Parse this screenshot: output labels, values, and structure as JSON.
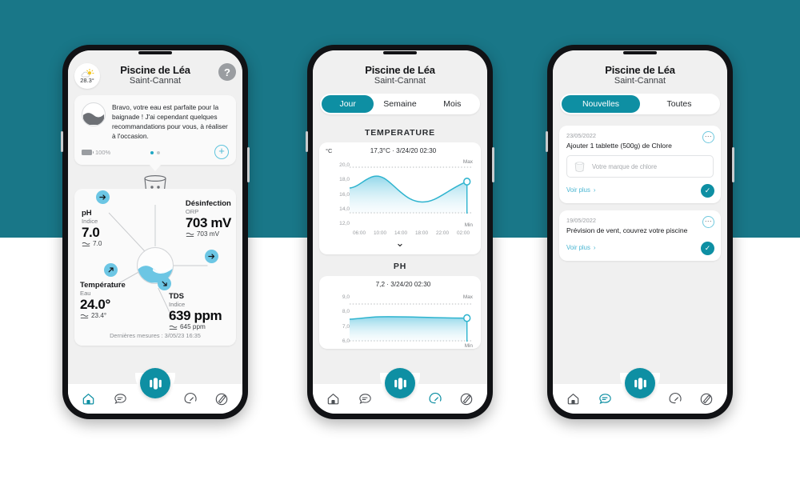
{
  "background": {
    "teal": "#197788",
    "white": "#ffffff"
  },
  "theme": {
    "accent": "#0e8fa3",
    "accent_light": "#4ab6d2",
    "chart_fill": "#5ec4e0",
    "muted": "#9a9da1"
  },
  "phone1": {
    "header": {
      "title": "Piscine de Léa",
      "subtitle": "Saint-Cannat",
      "weather_temp": "28.3°",
      "weather_icon": "sun-behind-cloud-icon",
      "help_label": "?"
    },
    "advice": {
      "avatar_icon": "water-wave-avatar-icon",
      "text": "Bravo, votre eau est parfaite pour la baignade ! J'ai cependant quelques recommandations pour vous, à réaliser à l'occasion.",
      "battery_label": "100%",
      "battery_icon": "battery-full-icon",
      "add_label": "+",
      "dots": 2,
      "active_dot": 0
    },
    "device_icon": "pool-sensor-device-icon",
    "hub_icon": "water-wave-logo-icon",
    "metrics": [
      {
        "name": "pH",
        "kind": "Indice",
        "value": "7.0",
        "previous": "7.0",
        "arrow": "arrow-right-icon",
        "trend": "flat"
      },
      {
        "name": "Désinfection",
        "kind": "ORP",
        "value": "703 mV",
        "previous": "703 mV",
        "arrow": "arrow-right-icon",
        "trend": "flat"
      },
      {
        "name": "Température",
        "kind": "Eau",
        "value": "24.0°",
        "previous": "23.4°",
        "arrow": "arrow-up-right-icon",
        "trend": "up"
      },
      {
        "name": "TDS",
        "kind": "Indice",
        "value": "639 ppm",
        "previous": "645 ppm",
        "arrow": "arrow-down-right-icon",
        "trend": "down"
      }
    ],
    "last_measure": "Dernières mesures : 3/05/23 16:35",
    "nav": {
      "items": [
        {
          "icon": "home-icon",
          "name": "nav-home",
          "active": true
        },
        {
          "icon": "chat-bubble-icon",
          "name": "nav-messages",
          "active": false
        },
        {
          "icon": "gauge-icon",
          "name": "nav-gauge",
          "active": false
        },
        {
          "icon": "test-strip-icon",
          "name": "nav-analysis",
          "active": false
        }
      ],
      "fab_icon": "device-capsule-icon"
    }
  },
  "phone2": {
    "header": {
      "title": "Piscine de Léa",
      "subtitle": "Saint-Cannat"
    },
    "tabs": [
      {
        "label": "Jour",
        "active": true
      },
      {
        "label": "Semaine",
        "active": false
      },
      {
        "label": "Mois",
        "active": false
      }
    ],
    "chevron": "chevron-down-icon",
    "nav": {
      "items": [
        {
          "icon": "home-icon",
          "name": "nav-home",
          "active": false
        },
        {
          "icon": "chat-bubble-icon",
          "name": "nav-messages",
          "active": false
        },
        {
          "icon": "gauge-icon",
          "name": "nav-gauge",
          "active": true
        },
        {
          "icon": "test-strip-icon",
          "name": "nav-analysis",
          "active": false
        }
      ],
      "fab_icon": "device-capsule-icon"
    }
  },
  "phone3": {
    "header": {
      "title": "Piscine de Léa",
      "subtitle": "Saint-Cannat"
    },
    "tabs": [
      {
        "label": "Nouvelles",
        "active": true
      },
      {
        "label": "Toutes",
        "active": false
      }
    ],
    "notifications": [
      {
        "date": "23/05/2022",
        "title": "Ajouter 1 tablette (500g) de Chlore",
        "product_placeholder": "Votre marque de chlore",
        "product_icon": "chlorine-bucket-icon",
        "see_more": "Voir plus",
        "more_icon": "more-options-icon",
        "check_icon": "check-circle-icon"
      },
      {
        "date": "19/05/2022",
        "title": "Prévision de vent, couvrez votre piscine",
        "product_placeholder": null,
        "see_more": "Voir plus",
        "more_icon": "more-options-icon",
        "check_icon": "check-circle-icon"
      }
    ],
    "nav": {
      "items": [
        {
          "icon": "home-icon",
          "name": "nav-home",
          "active": false
        },
        {
          "icon": "chat-bubble-icon",
          "name": "nav-messages",
          "active": true
        },
        {
          "icon": "gauge-icon",
          "name": "nav-gauge",
          "active": false
        },
        {
          "icon": "test-strip-icon",
          "name": "nav-analysis",
          "active": false
        }
      ],
      "fab_icon": "device-capsule-icon"
    }
  },
  "chart_data": [
    {
      "type": "area",
      "title": "TEMPERATURE",
      "caption": "17,3°C · 3/24/20 02:30",
      "unit_label": "°C",
      "ylabel": "°C",
      "xlabel": "",
      "ylim": [
        12.0,
        20.0
      ],
      "yticks": [
        "20,0",
        "18,0",
        "16,0",
        "14,0",
        "12,0"
      ],
      "ytick_values": [
        20.0,
        18.0,
        16.0,
        14.0,
        12.0
      ],
      "xticks": [
        "06:00",
        "10:00",
        "14:00",
        "18:00",
        "22:00",
        "02:00"
      ],
      "max_label": "Max",
      "min_label": "Min",
      "max_line": 19.4,
      "min_line": 13.2,
      "grid": false,
      "current_value": 17.3,
      "x": [
        0,
        1,
        2,
        3,
        4,
        5,
        6,
        7,
        8,
        9,
        10,
        11,
        12
      ],
      "values": [
        16.5,
        16.6,
        17.2,
        17.9,
        18.2,
        18.1,
        17.4,
        16.4,
        15.5,
        15.0,
        14.9,
        15.4,
        16.4,
        17.3
      ],
      "series_color": "#2fb4cf"
    },
    {
      "type": "area",
      "title": "PH",
      "caption": "7,2 · 3/24/20 02:30",
      "unit_label": "",
      "ylabel": "",
      "xlabel": "",
      "ylim": [
        5.6,
        9.4
      ],
      "yticks": [
        "9,0",
        "8,0",
        "7,0",
        "6,0"
      ],
      "ytick_values": [
        9.0,
        8.0,
        7.0,
        6.0
      ],
      "xticks": [],
      "max_label": "Max",
      "min_label": "Min",
      "max_line": 8.1,
      "min_line": 5.85,
      "grid": false,
      "current_value": 7.2,
      "x": [
        0,
        1,
        2,
        3,
        4,
        5,
        6,
        7,
        8,
        9,
        10,
        11,
        12
      ],
      "values": [
        7.12,
        7.16,
        7.22,
        7.25,
        7.26,
        7.25,
        7.23,
        7.21,
        7.19,
        7.18,
        7.18,
        7.19,
        7.2,
        7.2
      ],
      "series_color": "#2fb4cf"
    }
  ]
}
